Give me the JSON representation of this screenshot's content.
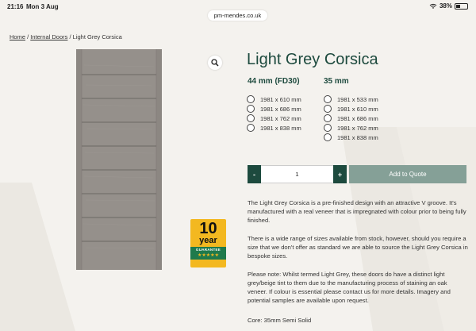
{
  "status_bar": {
    "time": "21:16",
    "date": "Mon 3 Aug",
    "battery": "38%"
  },
  "browser": {
    "url": "pm-mendes.co.uk"
  },
  "breadcrumb": {
    "home": "Home",
    "sep": " / ",
    "category": "Internal Doors",
    "current": "Light Grey Corsica"
  },
  "product": {
    "title": "Light Grey Corsica",
    "columns": [
      {
        "heading": "44 mm (FD30)",
        "sizes": [
          "1981 x 610 mm",
          "1981 x 686 mm",
          "1981 x 762 mm",
          "1981 x 838 mm"
        ]
      },
      {
        "heading": "35 mm",
        "sizes": [
          "1981 x 533 mm",
          "1981 x 610 mm",
          "1981 x 686 mm",
          "1981 x 762 mm",
          "1981 x 838 mm"
        ]
      }
    ],
    "quantity": "1",
    "minus_label": "-",
    "plus_label": "+",
    "quote_label": "Add to Quote",
    "description": [
      "The Light Grey Corsica is a pre-finished design with an attractive V groove. It's manufactured with a real veneer that is impregnated with colour prior to being fully finished.",
      "There is a wide range of sizes available from stock, however, should you require a size that we don't offer as standard we are able to source the Light Grey Corsica in bespoke sizes.",
      "Please note: Whilst termed Light Grey, these doors do have a distinct light grey/beige tint to them due to the manufacturing process of staining an oak veneer. If colour is essential please contact us for more details. Imagery and potential samples are available upon request.",
      "Core: 35mm Semi Solid"
    ]
  },
  "badge": {
    "number": "10",
    "word": "year",
    "label": "GUARANTEE",
    "stars": "★★★★★"
  },
  "colors": {
    "brand_green": "#1d4a3e",
    "quote_button": "#85a097",
    "badge_yellow": "#f3b820",
    "badge_green": "#1f7a4c"
  }
}
